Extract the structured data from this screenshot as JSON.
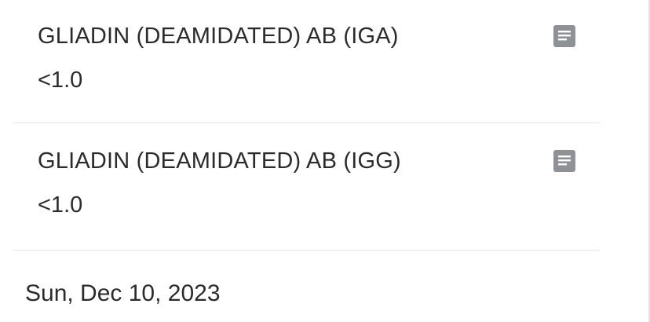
{
  "results": [
    {
      "name": "GLIADIN (DEAMIDATED) AB (IGA)",
      "value": "<1.0",
      "icon": "note-icon"
    },
    {
      "name": "GLIADIN (DEAMIDATED) AB (IGG)",
      "value": "<1.0",
      "icon": "note-icon"
    }
  ],
  "date_header": "Sun, Dec 10, 2023",
  "colors": {
    "text": "#2b2b2b",
    "icon": "#8e9196",
    "divider": "#e6e6e6",
    "background": "#ffffff"
  }
}
